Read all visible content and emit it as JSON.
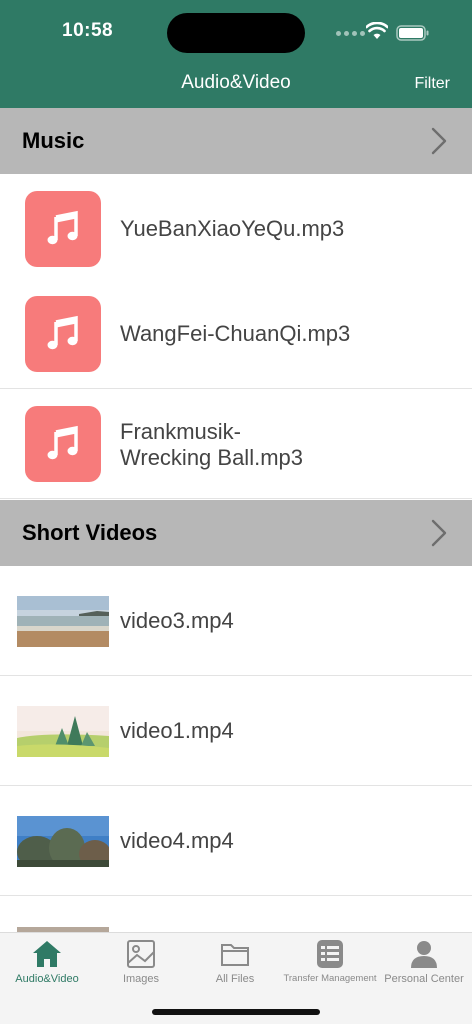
{
  "status_bar": {
    "time": "10:58"
  },
  "nav": {
    "title": "Audio&Video",
    "filter_label": "Filter"
  },
  "sections": {
    "music": {
      "title": "Music",
      "items": [
        {
          "name": "YueBanXiaoYeQu.mp3",
          "icon": "music-note-icon"
        },
        {
          "name": "WangFei-ChuanQi.mp3",
          "icon": "music-note-icon"
        },
        {
          "name": "Frankmusik-\nWrecking Ball.mp3",
          "icon": "music-note-icon"
        }
      ]
    },
    "videos": {
      "title": "Short Videos",
      "items": [
        {
          "name": "video3.mp4"
        },
        {
          "name": "video1.mp4"
        },
        {
          "name": "video4.mp4"
        }
      ]
    }
  },
  "tabbar": {
    "tabs": [
      {
        "label": "Audio&Video",
        "icon": "home-icon",
        "active": true
      },
      {
        "label": "Images",
        "icon": "image-icon",
        "active": false
      },
      {
        "label": "All Files",
        "icon": "folder-icon",
        "active": false
      },
      {
        "label": "Transfer Management",
        "icon": "list-icon",
        "active": false
      },
      {
        "label": "Personal Center",
        "icon": "person-icon",
        "active": false
      }
    ]
  },
  "colors": {
    "header": "#2f7a65",
    "music_icon_bg": "#f77b7b",
    "section_bg": "#b7b7b7",
    "active_tab": "#2f7a65"
  }
}
